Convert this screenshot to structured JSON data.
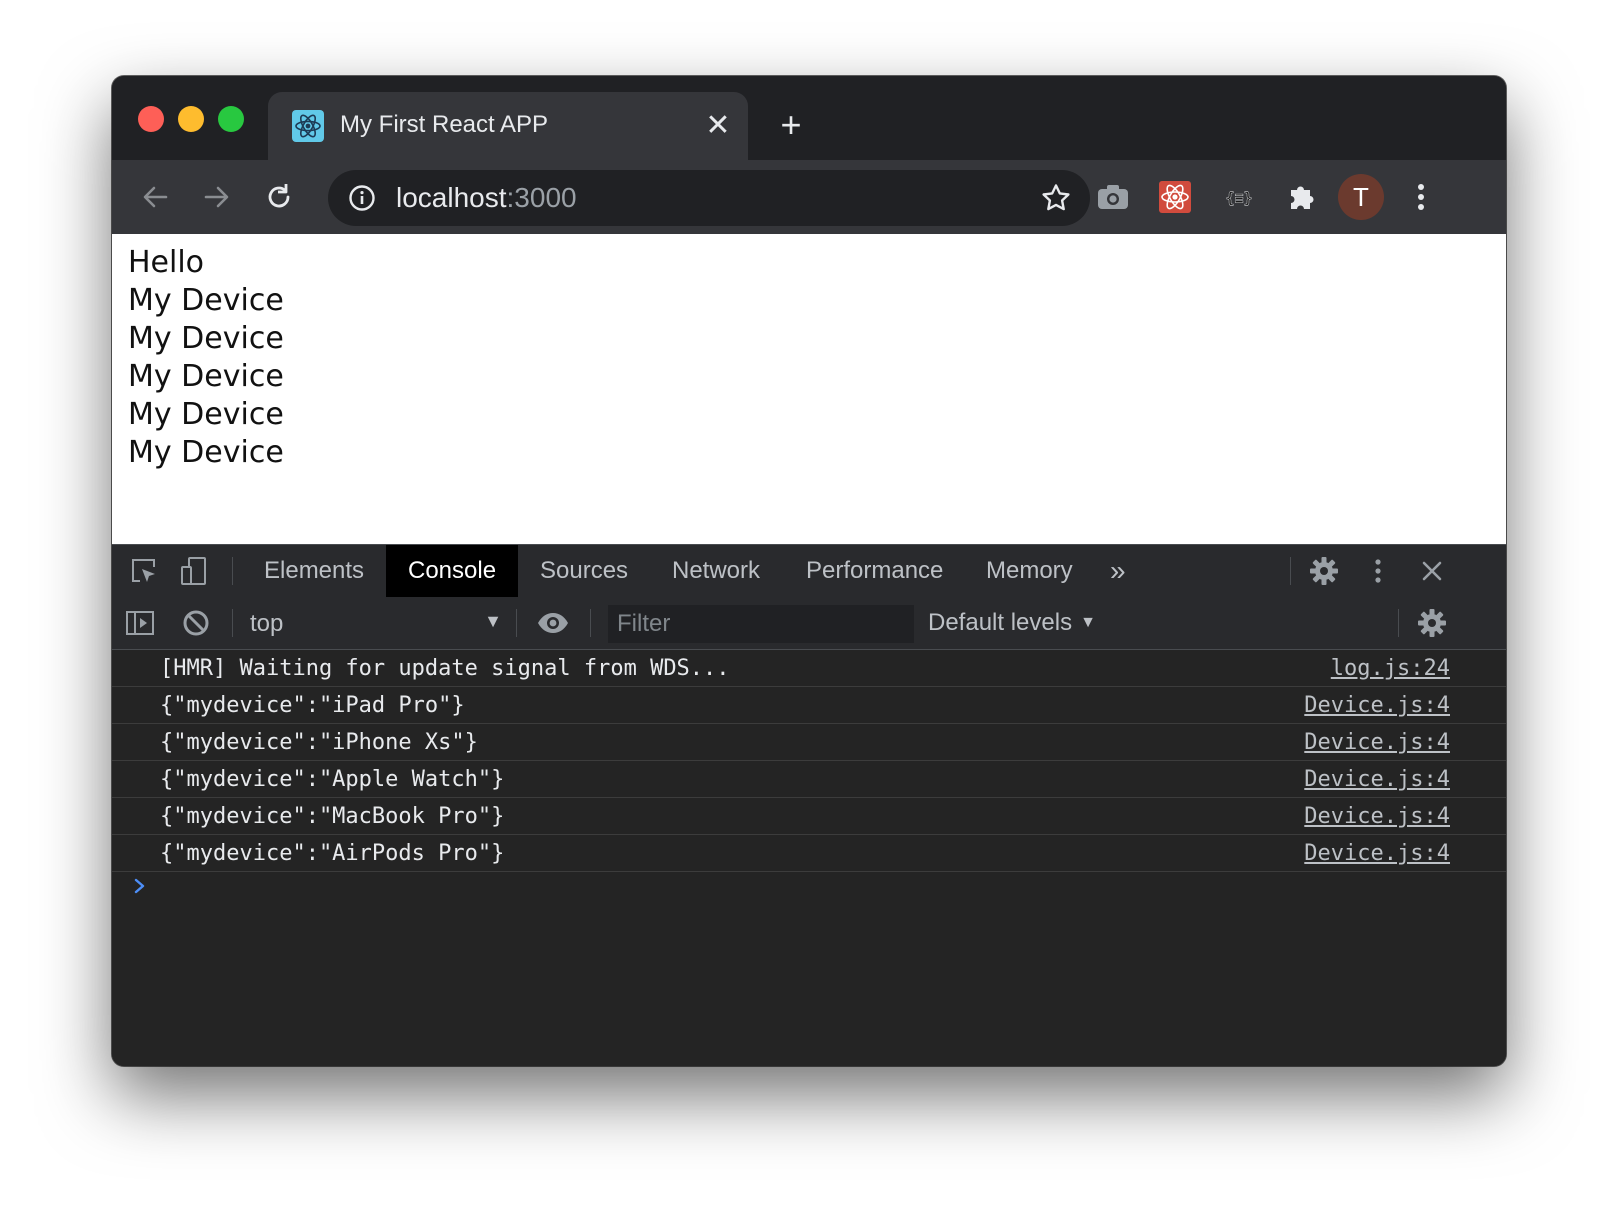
{
  "tab": {
    "title": "My First React APP",
    "favicon": "react-icon",
    "close_symbol": "✕",
    "new_tab_symbol": "+"
  },
  "omnibox": {
    "host": "localhost",
    "port": ":3000"
  },
  "toolbar": {
    "extensions": [
      "camera-icon",
      "react-devtools-icon",
      "json-viewer-icon",
      "puzzle-icon"
    ],
    "profile_initial": "T",
    "colors": {
      "profile_bg": "#6b3a2e",
      "react_ext_bg": "#d14b3d"
    }
  },
  "page": {
    "lines": [
      "Hello",
      "My Device",
      "My Device",
      "My Device",
      "My Device",
      "My Device"
    ]
  },
  "devtools": {
    "tabs": [
      "Elements",
      "Console",
      "Sources",
      "Network",
      "Performance",
      "Memory"
    ],
    "active_tab": "Console",
    "more_tabs_symbol": "»",
    "context": "top",
    "filter_placeholder": "Filter",
    "levels_label": "Default levels",
    "messages": [
      {
        "text": "[HMR] Waiting for update signal from WDS...",
        "source": "log.js:24"
      },
      {
        "text": "{\"mydevice\":\"iPad Pro\"}",
        "source": "Device.js:4"
      },
      {
        "text": "{\"mydevice\":\"iPhone Xs\"}",
        "source": "Device.js:4"
      },
      {
        "text": "{\"mydevice\":\"Apple Watch\"}",
        "source": "Device.js:4"
      },
      {
        "text": "{\"mydevice\":\"MacBook Pro\"}",
        "source": "Device.js:4"
      },
      {
        "text": "{\"mydevice\":\"AirPods Pro\"}",
        "source": "Device.js:4"
      }
    ],
    "prompt_color": "#4d8ef7"
  }
}
